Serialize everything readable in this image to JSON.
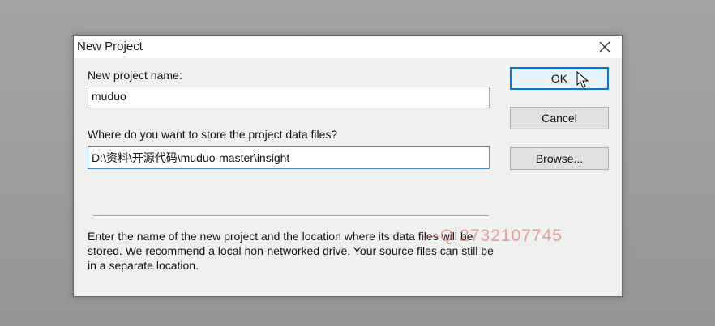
{
  "dialog": {
    "title": "New Project",
    "project_name_label": "New project name:",
    "project_name_value": "muduo",
    "location_label": "Where do you want to store the project data files?",
    "location_value": "D:\\资料\\开源代码\\muduo-master\\insight",
    "help_text": "Enter the name of the new project and the location where its data files will be stored. We recommend a local non-networked drive. Your source files can still be in a separate location.",
    "buttons": {
      "ok": "OK",
      "cancel": "Cancel",
      "browse": "Browse..."
    }
  },
  "overlay": {
    "watermark": "—Q 2732107745"
  },
  "icons": {
    "close": "close-icon",
    "cursor": "mouse-pointer-icon"
  },
  "colors": {
    "dialog_bg": "#f0f0f0",
    "default_button_border": "#0078d7",
    "default_button_bg": "#e5f1fb",
    "button_bg": "#e1e1e1",
    "watermark": "#d65c4a"
  }
}
